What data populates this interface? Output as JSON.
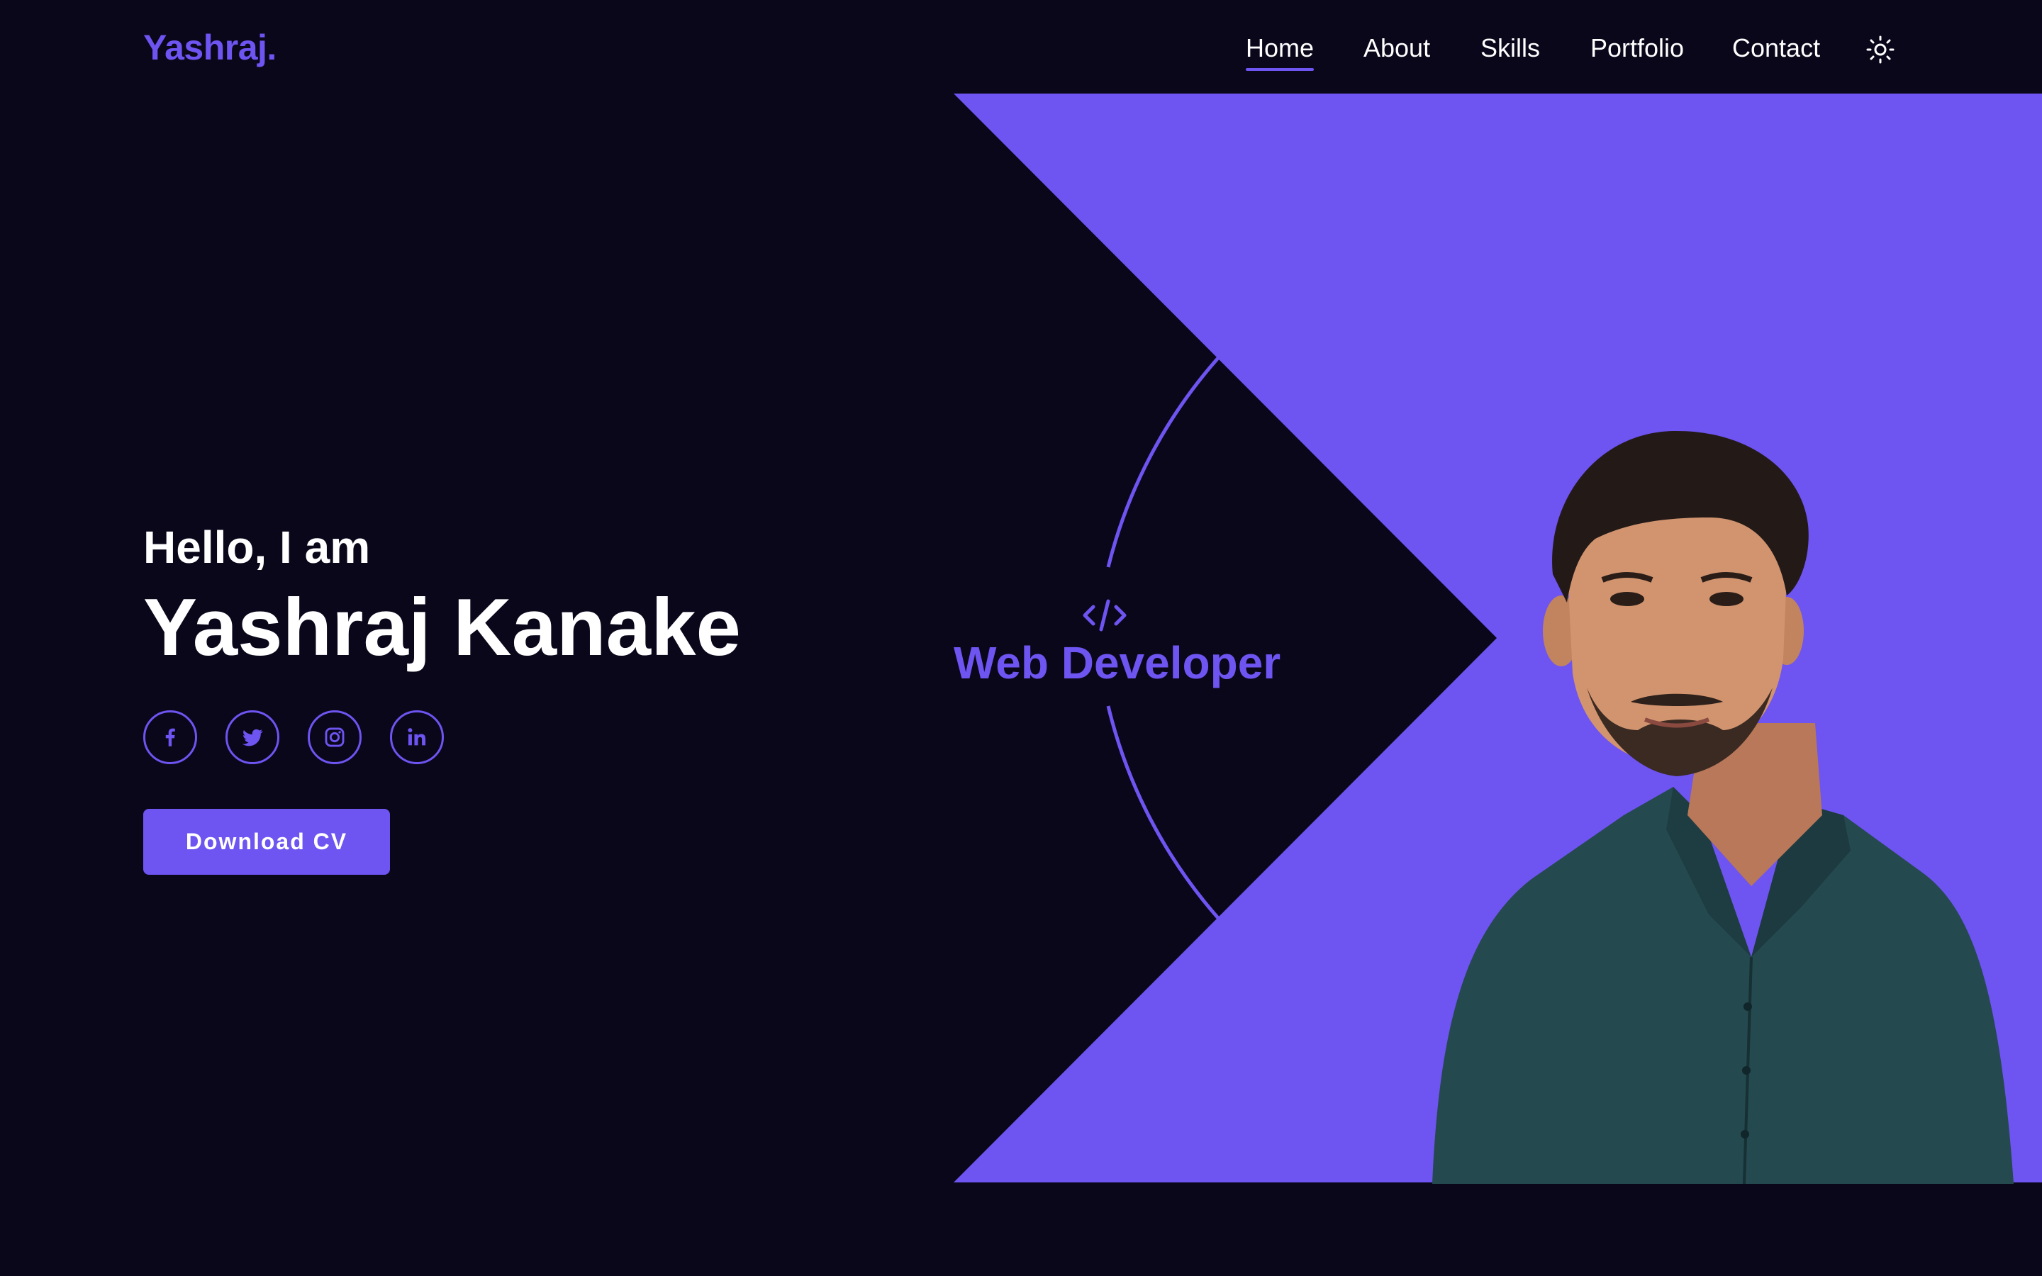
{
  "brand": {
    "logo": "Yashraj.",
    "accent": "#6e54f0",
    "background": "#0a071b"
  },
  "nav": {
    "items": [
      {
        "label": "Home",
        "active": true
      },
      {
        "label": "About",
        "active": false
      },
      {
        "label": "Skills",
        "active": false
      },
      {
        "label": "Portfolio",
        "active": false
      },
      {
        "label": "Contact",
        "active": false
      }
    ],
    "theme_toggle_icon": "sun-icon"
  },
  "hero": {
    "greeting": "Hello, I am",
    "name": "Yashraj Kanake",
    "socials": [
      {
        "icon": "facebook-icon"
      },
      {
        "icon": "twitter-icon"
      },
      {
        "icon": "instagram-icon"
      },
      {
        "icon": "linkedin-icon"
      }
    ],
    "cta_label": "Download CV",
    "role_icon": "code-icon",
    "role": "Web Developer",
    "photo_icon": "profile-photo"
  }
}
